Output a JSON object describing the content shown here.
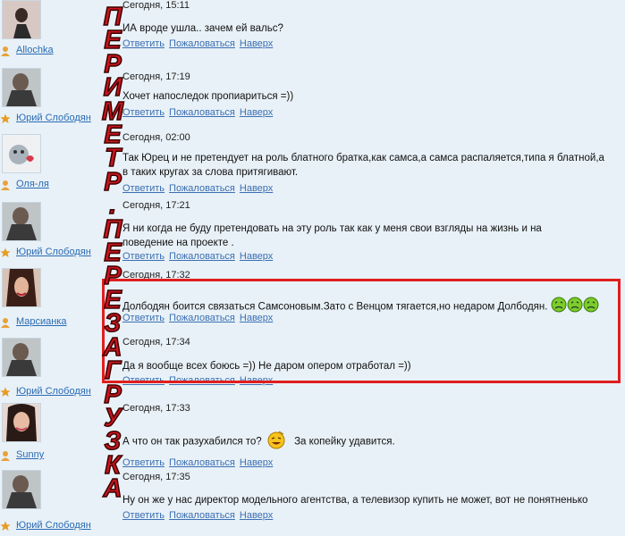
{
  "links": {
    "reply": "Ответить",
    "report": "Пожаловаться",
    "top": "Наверх"
  },
  "overlay_text": [
    "П",
    "Е",
    "Р",
    "И",
    "М",
    "Е",
    "Т",
    "Р",
    ".",
    "П",
    "Е",
    "Р",
    "Е",
    "З",
    "А",
    "Г",
    "Р",
    "У",
    "З",
    "К",
    "А"
  ],
  "comments": [
    {
      "user": "Allochka",
      "date": "Сегодня, 15:11",
      "text": "ИА вроде ушла.. зачем ей вальс?"
    },
    {
      "user": "Юрий Слободян",
      "date": "Сегодня, 17:19",
      "text": "Хочет напоследок пропиариться =))"
    },
    {
      "user": "Оля-ля",
      "date": "Сегодня, 02:00",
      "text": "Так Юрец и не претендует на роль блатного братка,как самса,а самса распаляется,типа я блатной,а в таких кругах за слова притягивают."
    },
    {
      "user": "Юрий Слободян",
      "date": "Сегодня, 17:21",
      "text": "Я ни когда не буду претендовать на эту роль так как у меня свои взгляды на жизнь и на поведение на проекте ."
    },
    {
      "user": "Марсианка",
      "date": "Сегодня, 17:32",
      "text": "Долбодян боится связаться Самсоновым.Зато с Венцом тягается,но недаром Долбодян."
    },
    {
      "user": "Юрий Слободян",
      "date": "Сегодня, 17:34",
      "text": "Да я вообще всех боюсь =)) Не даром опером отработал =))"
    },
    {
      "user": "Sunny",
      "date": "Сегодня, 17:33",
      "text_a": "А что он так разухабился то?",
      "text_b": "За копейку удавится."
    },
    {
      "user": "Юрий Слободян",
      "date": "Сегодня, 17:35",
      "text": "Ну он же у нас директор модельного агентства, а телевизор купить не может, вот не понятненько"
    }
  ]
}
